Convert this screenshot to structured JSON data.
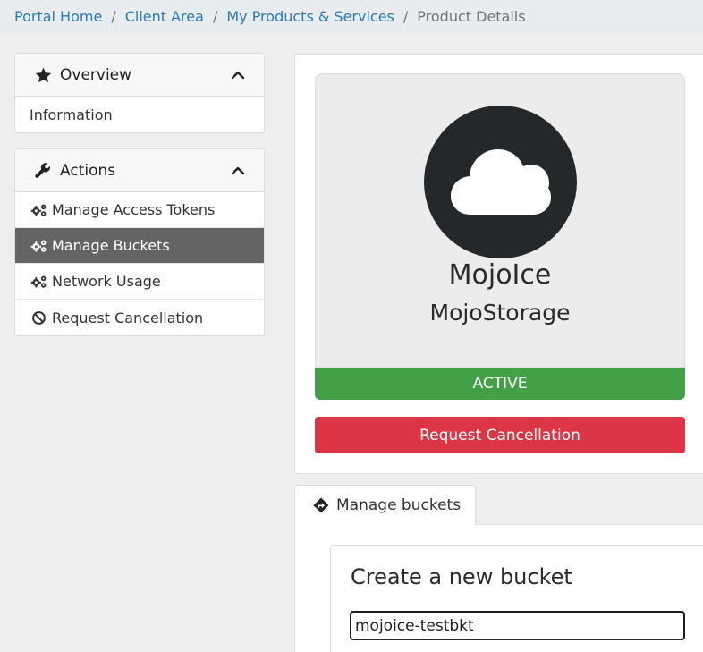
{
  "breadcrumb": {
    "items": [
      "Portal Home",
      "Client Area",
      "My Products & Services"
    ],
    "separator": "/",
    "current": "Product Details"
  },
  "sidebar": {
    "overview": {
      "title": "Overview",
      "icon": "star-icon",
      "items": [
        {
          "label": "Information"
        }
      ]
    },
    "actions": {
      "title": "Actions",
      "icon": "wrench-icon",
      "items": [
        {
          "label": "Manage Access Tokens",
          "icon": "gears-icon"
        },
        {
          "label": "Manage Buckets",
          "icon": "gears-icon",
          "active": true
        },
        {
          "label": "Network Usage",
          "icon": "gears-icon"
        },
        {
          "label": "Request Cancellation",
          "icon": "ban-icon"
        }
      ]
    }
  },
  "product": {
    "icon": "cloud-icon",
    "name": "MojoIce",
    "group": "MojoStorage",
    "status": "ACTIVE",
    "cancel_label": "Request Cancellation"
  },
  "tabs": {
    "manage_buckets": "Manage buckets",
    "icon": "directions-icon"
  },
  "create_bucket": {
    "title": "Create a new bucket",
    "input_value": "mojoice-testbkt"
  },
  "colors": {
    "link": "#2a7ab5",
    "active_item": "#646464",
    "status_active": "#43a047",
    "danger": "#dc3545",
    "icon_circle": "#25282b"
  }
}
